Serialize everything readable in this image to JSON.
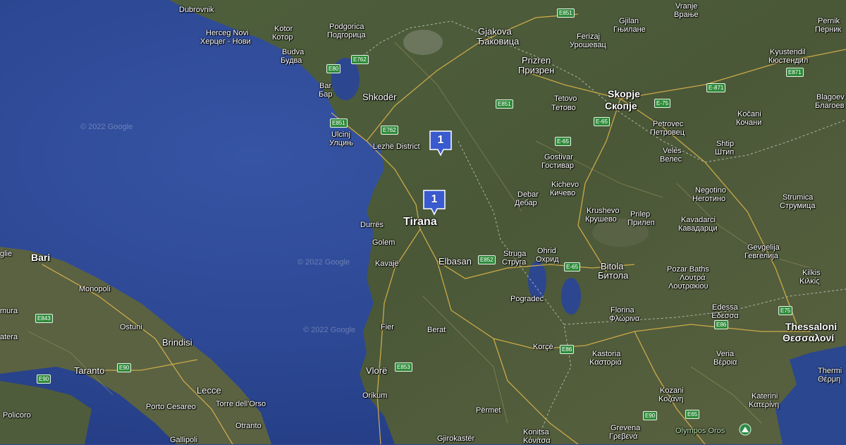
{
  "markers": [
    {
      "id": "marker-north",
      "count": "1"
    },
    {
      "id": "marker-tirana",
      "count": "1"
    }
  ],
  "labels": {
    "dubrovnik": "Dubrovnik",
    "herceg_novi": "Herceg Novi",
    "herceg_novi_cyr": "Херцег - Нови",
    "kotor": "Kotor",
    "kotor_cyr": "Котор",
    "budva": "Budva",
    "budva_cyr": "Будва",
    "bar": "Bar",
    "bar_cyr": "Бар",
    "ulcinj": "Ulcinj",
    "ulcinj_cyr": "Улцињ",
    "podgorica": "Podgorica",
    "podgorica_cyr": "Подгорица",
    "shkoder": "Shkodër",
    "lezhe": "Lezhë District",
    "durres": "Durrës",
    "tirana": "Tirana",
    "golem": "Golem",
    "kavaje": "Kavajë",
    "elbasan": "Elbasan",
    "fier": "Fier",
    "berat": "Berat",
    "vlore": "Vlorë",
    "orikum": "Orikum",
    "permet": "Përmet",
    "gjirokaster": "Gjirokastër",
    "korce": "Korçë",
    "pogradec": "Pogradec",
    "konitsa": "Konitsa",
    "konitsa_gr": "Κόνιτσα",
    "gjakova": "Gjakova",
    "gjakova_cyr": "Ђаковица",
    "prizren": "Prizren",
    "prizren_cyr": "Призрен",
    "ferizaj": "Ferizaj",
    "ferizaj_cyr": "Урошевац",
    "gjilan": "Gjilan",
    "gjilan_cyr": "Гњилане",
    "vranje": "Vranje",
    "vranje_cyr": "Врање",
    "tetovo": "Tetovo",
    "tetovo_cyr": "Тетово",
    "skopje": "Skopje",
    "skopje_cyr": "Скопје",
    "gostivar": "Gostivar",
    "gostivar_cyr": "Гостивар",
    "debar": "Debar",
    "debar_cyr": "Дебар",
    "kichevo": "Kichevo",
    "kichevo_cyr": "Кичево",
    "struga": "Struga",
    "struga_cyr": "Струга",
    "ohrid": "Ohrid",
    "ohrid_cyr": "Охрид",
    "krushevo": "Krushevo",
    "krushevo_cyr": "Крушево",
    "prilep": "Prilep",
    "prilep_cyr": "Прилеп",
    "bitola": "Bitola",
    "bitola_cyr": "Битола",
    "veles": "Veles",
    "veles_cyr": "Велес",
    "petrovec": "Petrovec",
    "petrovec_cyr": "Петровец",
    "shtip": "Shtip",
    "shtip_cyr": "Штип",
    "negotino": "Negotino",
    "negotino_cyr": "Неготино",
    "kavadarci": "Kavadarci",
    "kavadarci_cyr": "Кавадарци",
    "kocani": "Kočani",
    "kocani_cyr": "Кочани",
    "strumica": "Strumica",
    "strumica_cyr": "Струмица",
    "kyustendil": "Kyustendil",
    "kyustendil_cyr": "Кюстендил",
    "pernik": "Pernik",
    "pernik_cyr": "Перник",
    "blagoev": "Blagoev",
    "blagoev_cyr": "Благоев",
    "gevgelija": "Gevgelija",
    "gevgelija_cyr": "Гевгелија",
    "pozar_baths": "Pozar Baths",
    "loutra_gr1": "Λουτρά",
    "loutra_gr2": "Λουτρακίου",
    "florina": "Florina",
    "florina_gr": "Φλώρινα",
    "edessa": "Edessa",
    "edessa_gr": "Έδεσσα",
    "kastoria": "Kastoria",
    "kastoria_gr": "Καστοριά",
    "veria": "Veria",
    "veria_gr": "Βέροια",
    "kozani": "Kozani",
    "kozani_gr": "Κοζάνη",
    "grevena": "Grevena",
    "grevena_gr": "Γρεβενά",
    "katerini": "Katerini",
    "katerini_gr": "Κατερίνη",
    "thessaloniki": "Thessaloni",
    "thessaloniki_gr": "Θεσσαλονί",
    "thermi": "Thermi",
    "thermi_gr": "Θέρμη",
    "kilkis": "Kilkis",
    "kilkis_gr": "Κιλκίς",
    "olympos": "Olympos Oros",
    "bari": "Bari",
    "monopoli": "Monopoli",
    "ostuni": "Ostuni",
    "brindisi": "Brindisi",
    "taranto": "Taranto",
    "lecce": "Lecce",
    "porto_cesareo": "Porto Cesareo",
    "torre_orso": "Torre dell'Orso",
    "otranto": "Otranto",
    "gallipoli": "Gallipoli",
    "policoro": "Policoro",
    "altamura": "mura",
    "matera": "atera",
    "glie": "glie"
  },
  "roads": {
    "e762a": "E762",
    "e80": "E80",
    "e851a": "E851",
    "e762b": "E762",
    "e851b": "E851",
    "e851c": "E851",
    "e75a": "E-75",
    "e65a": "E-65",
    "e65b": "E-65",
    "e871a": "E-871",
    "e871b": "E871",
    "e852": "E852",
    "e65c": "E-65",
    "e853": "E853",
    "e86a": "E86",
    "e86b": "E86",
    "e75b": "E75",
    "e90a": "E90",
    "e90b": "E90",
    "e65d": "E65",
    "e90c": "E90",
    "e843": "E843"
  },
  "watermarks": [
    "© 2022 Google",
    "© 2022 Google",
    "© 2022 Google"
  ],
  "colors": {
    "sea": "#2f4a9a",
    "land": "#4a5a3a",
    "marker": "#3a5bd0",
    "road_shield": "#2f8a3a"
  },
  "icons": {
    "peak": "mountain-peak-icon",
    "marker": "map-marker-cluster-icon"
  }
}
